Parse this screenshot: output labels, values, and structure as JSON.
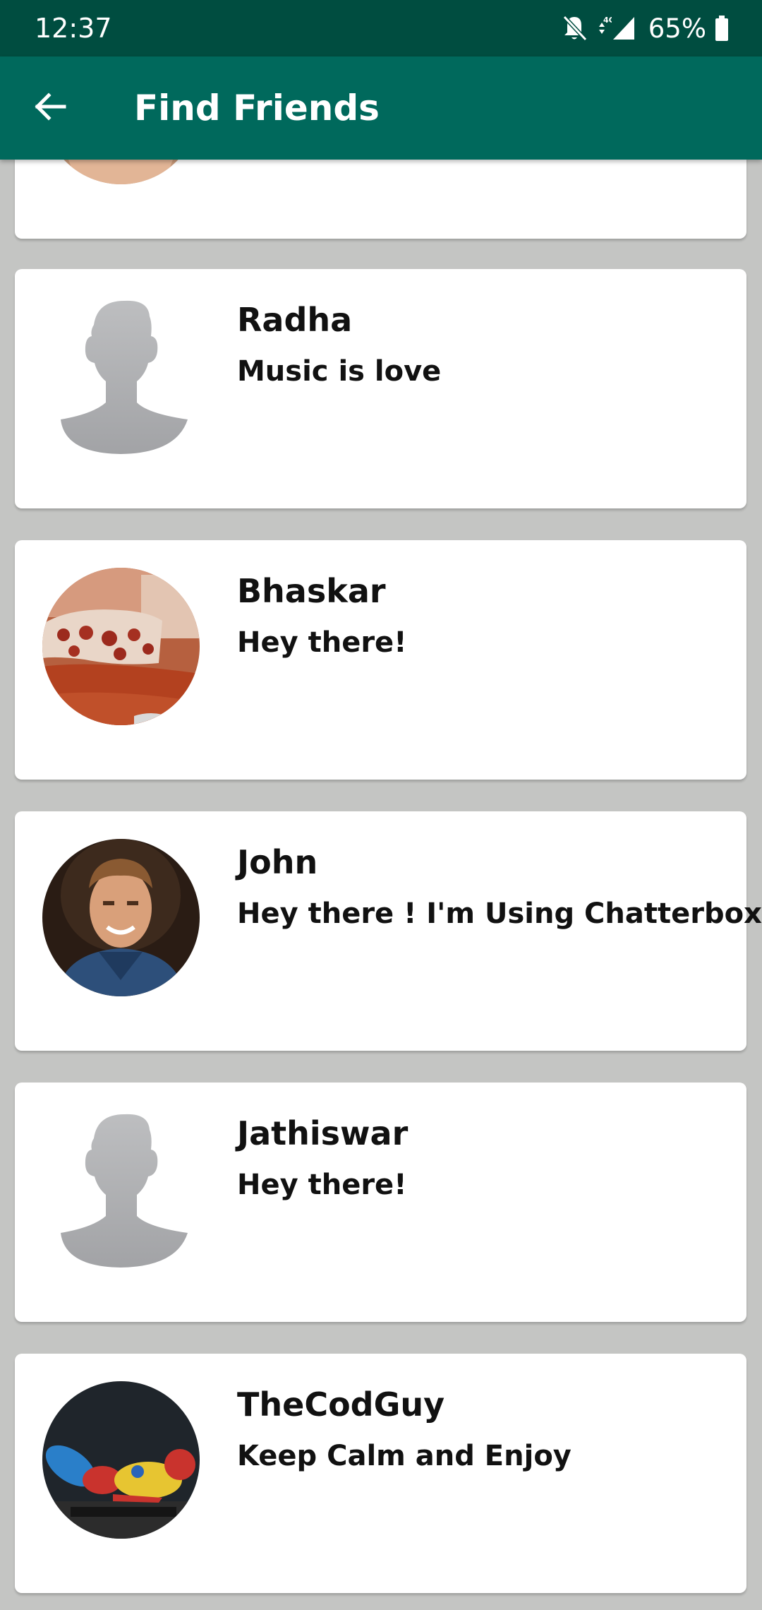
{
  "status_bar": {
    "time": "12:37",
    "battery": "65%",
    "network": "4G",
    "icons": [
      "bell-muted-icon",
      "network-4g-icon",
      "signal-icon",
      "battery-icon"
    ]
  },
  "app_bar": {
    "title": "Find Friends",
    "back_icon": "arrow-left-icon"
  },
  "colors": {
    "status_bar": "#004d40",
    "app_bar": "#00695c",
    "background": "#c4c5c3",
    "card": "#ffffff"
  },
  "friends": [
    {
      "name": "",
      "status": "",
      "avatar": "photo-face"
    },
    {
      "name": "Radha",
      "status": "Music is love",
      "avatar": "default-silhouette"
    },
    {
      "name": "Bhaskar",
      "status": "Hey there!",
      "avatar": "photo-sofa"
    },
    {
      "name": "John",
      "status": "Hey there ! I'm Using Chatterbox",
      "avatar": "photo-man"
    },
    {
      "name": "Jathiswar",
      "status": "Hey there!",
      "avatar": "default-silhouette"
    },
    {
      "name": "TheCodGuy",
      "status": "Keep Calm and Enjoy",
      "avatar": "photo-toy"
    }
  ]
}
